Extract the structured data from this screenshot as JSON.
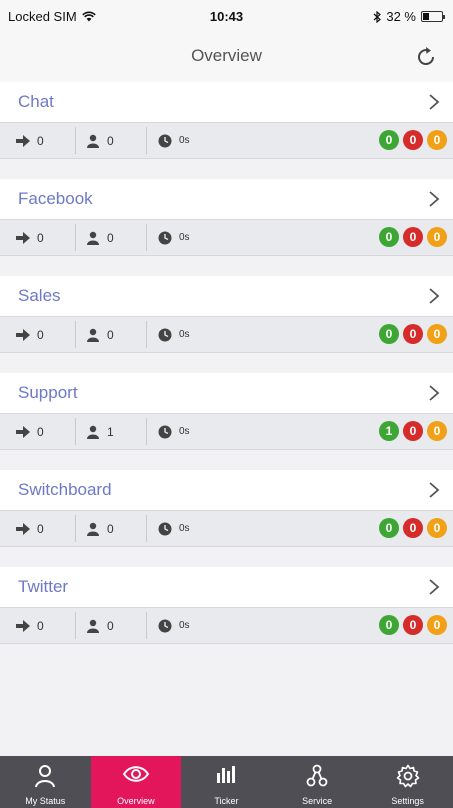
{
  "statusbar": {
    "carrier": "Locked SIM",
    "time": "10:43",
    "battery": "32 %",
    "battery_level": 0.32
  },
  "header": {
    "title": "Overview",
    "refresh_icon": "refresh-icon"
  },
  "groups": [
    {
      "name": "Chat",
      "transfers": "0",
      "agents": "0",
      "wait": "0s",
      "badges": [
        "0",
        "0",
        "0"
      ]
    },
    {
      "name": "Facebook",
      "transfers": "0",
      "agents": "0",
      "wait": "0s",
      "badges": [
        "0",
        "0",
        "0"
      ]
    },
    {
      "name": "Sales",
      "transfers": "0",
      "agents": "0",
      "wait": "0s",
      "badges": [
        "0",
        "0",
        "0"
      ]
    },
    {
      "name": "Support",
      "transfers": "0",
      "agents": "1",
      "wait": "0s",
      "badges": [
        "1",
        "0",
        "0"
      ]
    },
    {
      "name": "Switchboard",
      "transfers": "0",
      "agents": "0",
      "wait": "0s",
      "badges": [
        "0",
        "0",
        "0"
      ]
    },
    {
      "name": "Twitter",
      "transfers": "0",
      "agents": "0",
      "wait": "0s",
      "badges": [
        "0",
        "0",
        "0"
      ]
    }
  ],
  "colors": {
    "accent": "#e3165b",
    "group_title": "#6c79c7",
    "badge_green": "#3da634",
    "badge_red": "#d62b2b",
    "badge_orange": "#f0a117",
    "tabbar": "#4e4e54"
  },
  "tabs": [
    {
      "label": "My Status",
      "icon": "person-icon",
      "active": false
    },
    {
      "label": "Overview",
      "icon": "eye-icon",
      "active": true
    },
    {
      "label": "Ticker",
      "icon": "bar-chart-icon",
      "active": false
    },
    {
      "label": "Service",
      "icon": "nodes-icon",
      "active": false
    },
    {
      "label": "Settings",
      "icon": "gear-icon",
      "active": false
    }
  ]
}
